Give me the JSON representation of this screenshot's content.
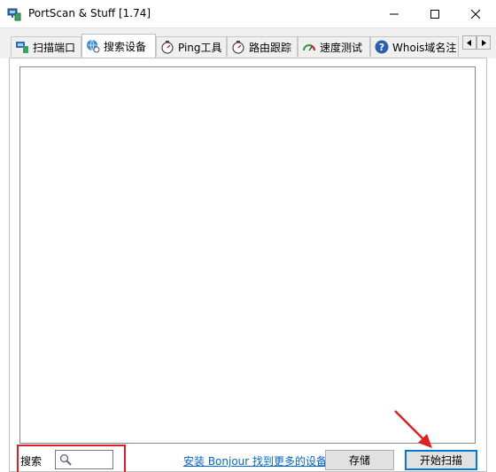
{
  "window": {
    "title": "PortScan & Stuff [1.74]"
  },
  "tabs": [
    {
      "label": "扫描端口",
      "icon": "network-scan-icon",
      "active": false
    },
    {
      "label": "搜索设备",
      "icon": "globe-search-icon",
      "active": true
    },
    {
      "label": "Ping工具",
      "icon": "stopwatch-icon",
      "active": false
    },
    {
      "label": "路由跟踪",
      "icon": "stopwatch-icon",
      "active": false
    },
    {
      "label": "速度测试",
      "icon": "speedometer-icon",
      "active": false
    },
    {
      "label": "Whois域名注",
      "icon": "question-icon",
      "active": false
    }
  ],
  "search": {
    "label": "搜索",
    "value": "",
    "icon": "magnifier-icon"
  },
  "bonjour_link": "安装 Bonjour 找到更多的设备",
  "buttons": {
    "save": "存储",
    "start_scan": "开始扫描"
  },
  "colors": {
    "annotation": "#e02020",
    "link": "#0066cc",
    "default_button_border": "#0078d7"
  }
}
